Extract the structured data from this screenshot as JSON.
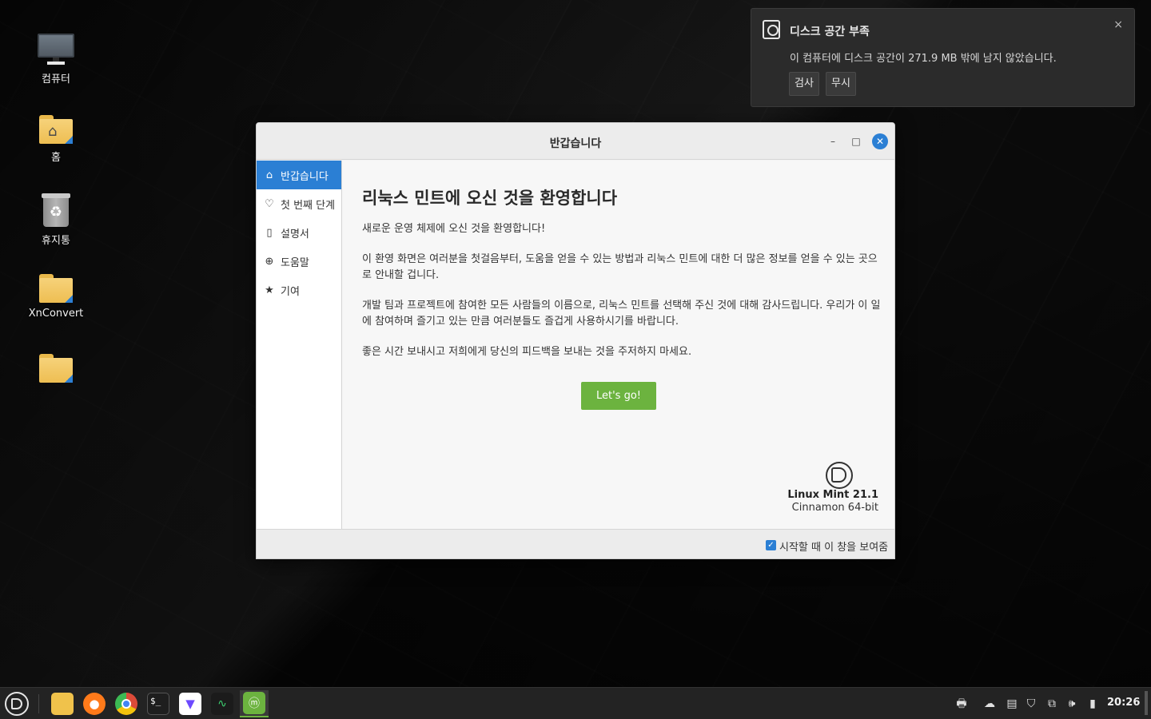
{
  "desktop": {
    "icons": [
      {
        "label": "컴퓨터",
        "icon": "computer-icon"
      },
      {
        "label": "홈",
        "icon": "home-folder-icon"
      },
      {
        "label": "휴지통",
        "icon": "trash-icon"
      },
      {
        "label": "XnConvert",
        "icon": "folder-icon"
      },
      {
        "label": "",
        "icon": "folder-icon"
      }
    ]
  },
  "notification": {
    "title": "디스크 공간 부족",
    "body": "이 컴퓨터에 디스크 공간이 271.9 MB 밖에 남지 않았습니다.",
    "close": "×",
    "buttons": {
      "examine": "검사",
      "ignore": "무시"
    }
  },
  "window": {
    "title": "반갑습니다",
    "controls": {
      "minimize": "–",
      "maximize": "□",
      "close": "✕"
    },
    "sidebar": {
      "items": [
        {
          "label": "반갑습니다",
          "icon": "⌂",
          "active": true
        },
        {
          "label": "첫 번째 단계",
          "icon": "♡"
        },
        {
          "label": "설명서",
          "icon": "▯"
        },
        {
          "label": "도움말",
          "icon": "⊕"
        },
        {
          "label": "기여",
          "icon": "★"
        }
      ]
    },
    "content": {
      "heading": "리눅스 민트에 오신 것을 환영합니다",
      "paragraphs": [
        "새로운 운영 체제에 오신 것을 환영합니다!",
        "이 환영 화면은 여러분을 첫걸음부터, 도움을 얻을 수 있는 방법과 리눅스 민트에 대한 더 많은 정보를 얻을 수 있는 곳으로 안내할 겁니다.",
        "개발 팀과 프로젝트에 참여한 모든 사람들의 이름으로, 리눅스 민트를 선택해 주신 것에 대해 감사드립니다. 우리가 이 일에 참여하며 즐기고 있는 만큼 여러분들도 즐겁게 사용하시기를 바랍니다.",
        "좋은 시간 보내시고 저희에게 당신의 피드백을 보내는 것을 주저하지 마세요."
      ],
      "go_button": "Let's go!",
      "version_name": "Linux Mint 21.1",
      "edition": "Cinnamon 64-bit"
    },
    "footer": {
      "show_on_startup_label": "시작할 때 이 창을 보여줌",
      "show_on_startup_checked": true,
      "check_mark": "✓"
    }
  },
  "taskbar": {
    "apps": [
      {
        "name": "files",
        "icon": "folder-icon",
        "color": "#f0c24b"
      },
      {
        "name": "firefox",
        "icon": "firefox-icon",
        "color": "#ff7a1a"
      },
      {
        "name": "chrome",
        "icon": "chrome-icon",
        "color": "#dd4b39"
      },
      {
        "name": "terminal",
        "icon": "terminal-icon",
        "color": "#1e1e1e"
      },
      {
        "name": "proton-vpn",
        "icon": "vpn-icon",
        "color": "#ffffff"
      },
      {
        "name": "system-monitor",
        "icon": "monitor-graph-icon",
        "color": "#1b1b1b"
      },
      {
        "name": "mint-welcome",
        "icon": "mint-icon",
        "color": "#6cb33f",
        "active": true
      }
    ],
    "clock": "20:26",
    "tray": [
      "printer-icon",
      "cloud-icon",
      "clipboard-icon",
      "shield-icon",
      "network-icon",
      "volume-icon",
      "battery-icon"
    ]
  },
  "colors": {
    "accent": "#2b7fd4",
    "go_button": "#6cb33f"
  }
}
